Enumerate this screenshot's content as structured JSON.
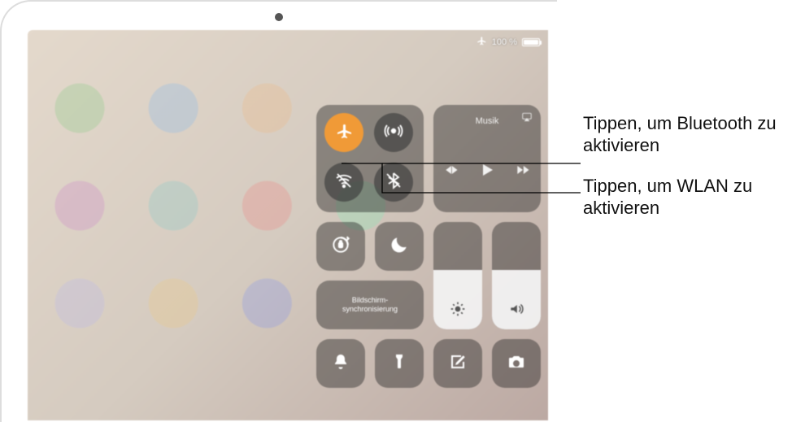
{
  "status": {
    "airplane_active": true,
    "battery_percent": "100 %"
  },
  "control_center": {
    "connectivity": {
      "airplane_on": true,
      "airdrop_on": false,
      "wifi_on": false,
      "bluetooth_on": false
    },
    "music": {
      "title": "Musik"
    },
    "screen_mirroring_label": "Bildschirm-\nsynchronisierung",
    "brightness_percent": 55,
    "volume_percent": 55
  },
  "callouts": {
    "bluetooth": "Tippen, um Bluetooth zu aktivieren",
    "wlan": "Tippen, um WLAN zu aktivieren"
  }
}
